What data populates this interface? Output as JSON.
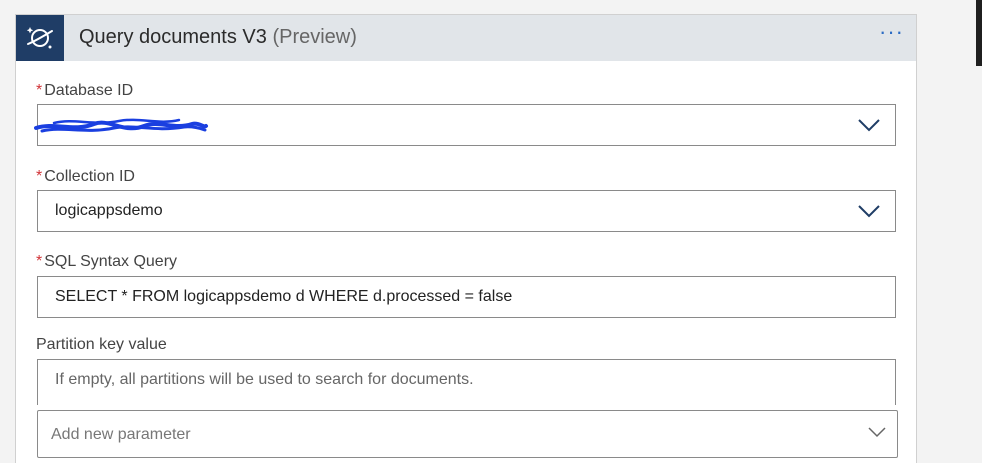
{
  "card": {
    "title": "Query documents V3",
    "title_suffix": "(Preview)",
    "more_label": "···",
    "app_icon": "cosmos-db-planet-icon"
  },
  "fields": {
    "database_id": {
      "required_mark": "*",
      "label": "Database ID",
      "value": ""
    },
    "collection_id": {
      "required_mark": "*",
      "label": "Collection ID",
      "value": "logicappsdemo"
    },
    "sql_query": {
      "required_mark": "*",
      "label": "SQL Syntax Query",
      "value": "SELECT * FROM logicappsdemo d WHERE d.processed = false"
    },
    "partition_key": {
      "label": "Partition key value",
      "placeholder": "If empty, all partitions will be used to search for documents."
    }
  },
  "add_parameter": {
    "placeholder": "Add new parameter"
  },
  "colors": {
    "header_bg": "#e1e5e9",
    "icon_bg": "#1f3d66",
    "required": "#d13438",
    "accent": "#2b6cc4",
    "redaction": "#1a3fe0"
  }
}
